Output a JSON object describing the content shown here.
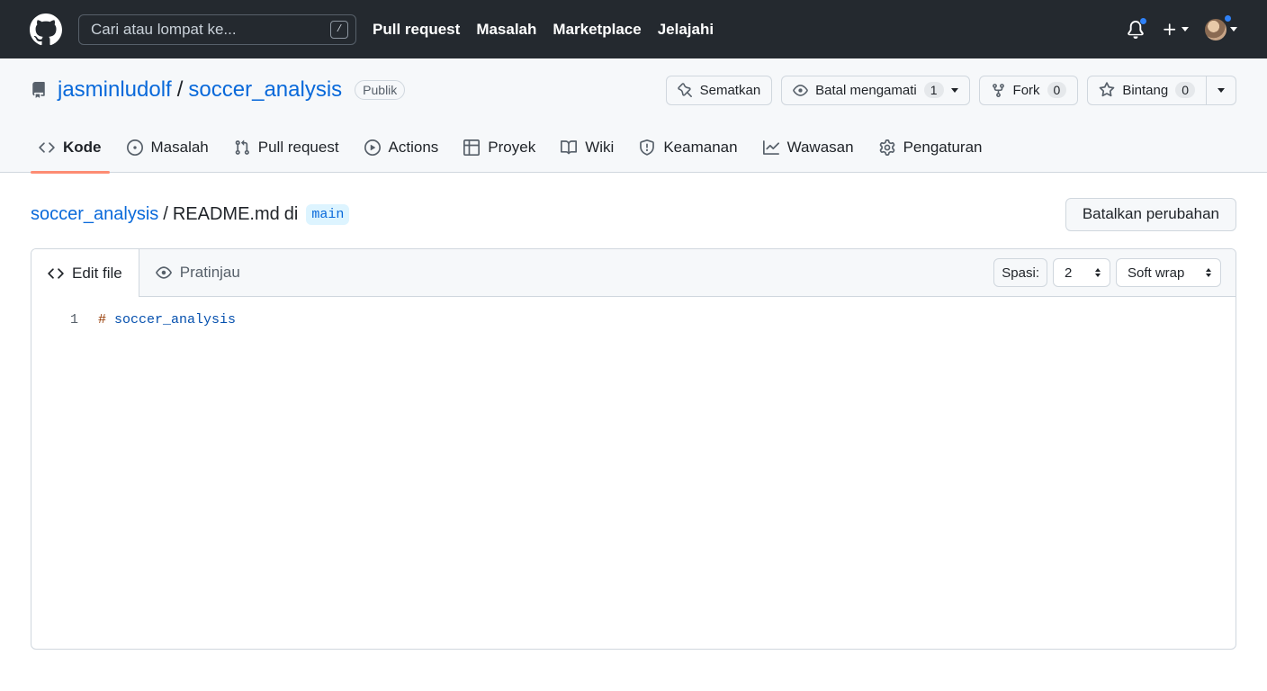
{
  "header": {
    "search_placeholder": "Cari atau lompat ke...",
    "search_shortcut": "/",
    "nav": [
      "Pull request",
      "Masalah",
      "Marketplace",
      "Jelajahi"
    ]
  },
  "repo": {
    "owner": "jasminludolf",
    "separator": "/",
    "name": "soccer_analysis",
    "visibility": "Publik",
    "pin_label": "Sematkan",
    "watch_label": "Batal mengamati",
    "watch_count": "1",
    "fork_label": "Fork",
    "fork_count": "0",
    "star_label": "Bintang",
    "star_count": "0"
  },
  "tabs": [
    {
      "label": "Kode",
      "icon": "code-icon",
      "active": true
    },
    {
      "label": "Masalah",
      "icon": "issue-icon"
    },
    {
      "label": "Pull request",
      "icon": "pull-request-icon"
    },
    {
      "label": "Actions",
      "icon": "play-icon"
    },
    {
      "label": "Proyek",
      "icon": "table-icon"
    },
    {
      "label": "Wiki",
      "icon": "book-icon"
    },
    {
      "label": "Keamanan",
      "icon": "shield-icon"
    },
    {
      "label": "Wawasan",
      "icon": "graph-icon"
    },
    {
      "label": "Pengaturan",
      "icon": "gear-icon"
    }
  ],
  "file": {
    "repo_link": "soccer_analysis",
    "path_sep": "/",
    "filename": "README.md",
    "in_word": "di",
    "branch": "main",
    "cancel_label": "Batalkan perubahan"
  },
  "editor": {
    "edit_tab": "Edit file",
    "preview_tab": "Pratinjau",
    "indent_label": "Spasi:",
    "indent_value": "2",
    "wrap_value": "Soft wrap",
    "lines": [
      {
        "number": "1",
        "hash": "#",
        "text": "soccer_analysis"
      }
    ]
  },
  "colors": {
    "header_bg": "#24292f",
    "link": "#0969da",
    "active_tab_underline": "#fd8c73",
    "notification_dot": "#2f81f7"
  }
}
